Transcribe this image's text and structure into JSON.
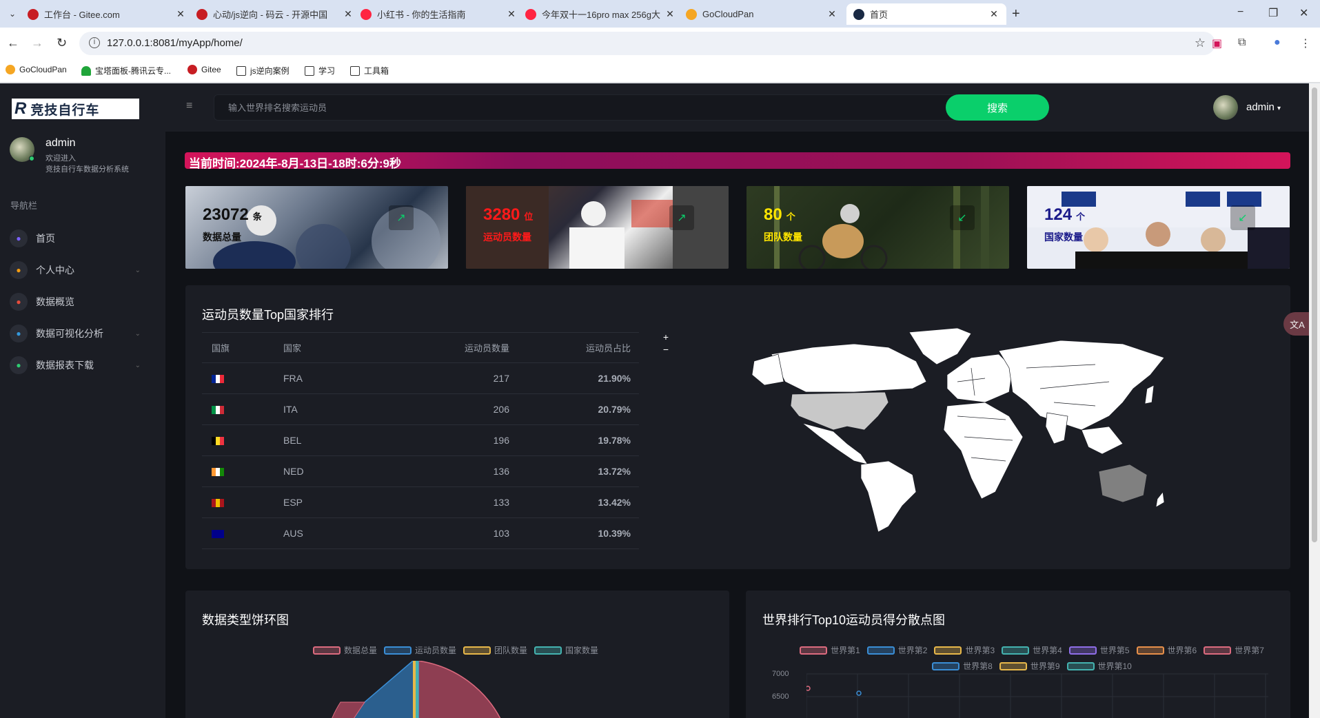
{
  "browser": {
    "tabs": [
      {
        "title": "工作台 - Gitee.com",
        "icon": "gitee-icon",
        "color": "#c71d23"
      },
      {
        "title": "心动/js逆向 - 码云 - 开源中国",
        "icon": "gitee-icon",
        "color": "#c71d23"
      },
      {
        "title": "小红书 - 你的生活指南",
        "icon": "xiaohongshu-icon",
        "color": "#ff2442"
      },
      {
        "title": "今年双十一16pro max 256g大",
        "icon": "xiaohongshu-icon",
        "color": "#ff2442"
      },
      {
        "title": "GoCloudPan",
        "icon": "gocloudpan-icon",
        "color": "#f5a623"
      },
      {
        "title": "首页",
        "icon": "app-logo-icon",
        "color": "#1a2a44",
        "active": true
      }
    ],
    "url": "127.0.0.1:8081/myApp/home/",
    "bookmarks": [
      "GoCloudPan",
      "宝塔面板-腾讯云专...",
      "Gitee",
      "js逆向案例",
      "学习",
      "工具箱"
    ]
  },
  "sidebar": {
    "logo_text": "竞技自行车",
    "user": {
      "name": "admin",
      "line1": "欢迎进入",
      "line2": "竞技自行车数据分析系统"
    },
    "nav_header": "导航栏",
    "items": [
      {
        "label": "首页",
        "icon": "home-icon",
        "color": "#7b61ff",
        "has_children": false
      },
      {
        "label": "个人中心",
        "icon": "user-icon",
        "color": "#f39c12",
        "has_children": true
      },
      {
        "label": "数据概览",
        "icon": "database-icon",
        "color": "#e74c3c",
        "has_children": false
      },
      {
        "label": "数据可视化分析",
        "icon": "chart-icon",
        "color": "#3498db",
        "has_children": true
      },
      {
        "label": "数据报表下载",
        "icon": "download-icon",
        "color": "#2ecc71",
        "has_children": true
      }
    ]
  },
  "topbar": {
    "search_placeholder": "输入世界排名搜索运动员",
    "search_button": "搜索",
    "username": "admin"
  },
  "time_text": "当前时间:2024年-8月-13日-18时:6分:9秒",
  "stats": [
    {
      "value": "23072",
      "unit": "条",
      "label": "数据总量",
      "color": "#111111",
      "arrow": "↗"
    },
    {
      "value": "3280",
      "unit": "位",
      "label": "运动员数量",
      "color": "#ff1a1a",
      "arrow": "↗"
    },
    {
      "value": "80",
      "unit": "个",
      "label": "团队数量",
      "color": "#ffe600",
      "arrow": "↙"
    },
    {
      "value": "124",
      "unit": "个",
      "label": "国家数量",
      "color": "#1a1a8a",
      "arrow": "↙"
    }
  ],
  "country_panel": {
    "title": "运动员数量Top国家排行",
    "headers": [
      "国旗",
      "国家",
      "运动员数量",
      "运动员占比"
    ],
    "rows": [
      {
        "country": "FRA",
        "count": "217",
        "pct": "21.90%",
        "flag": [
          "#002395",
          "#ffffff",
          "#ed2939"
        ]
      },
      {
        "country": "ITA",
        "count": "206",
        "pct": "20.79%",
        "flag": [
          "#009246",
          "#ffffff",
          "#ce2b37"
        ]
      },
      {
        "country": "BEL",
        "count": "196",
        "pct": "19.78%",
        "flag": [
          "#000000",
          "#fdda24",
          "#ef3340"
        ]
      },
      {
        "country": "NED",
        "count": "136",
        "pct": "13.72%",
        "flag": [
          "#ff9933",
          "#ffffff",
          "#138808"
        ]
      },
      {
        "country": "ESP",
        "count": "133",
        "pct": "13.42%",
        "flag": [
          "#aa151b",
          "#f1bf00",
          "#aa151b"
        ]
      },
      {
        "country": "AUS",
        "count": "103",
        "pct": "10.39%",
        "flag": [
          "#00008b",
          "#00008b",
          "#00008b"
        ]
      }
    ],
    "zoom_in": "+",
    "zoom_out": "−"
  },
  "pie_panel": {
    "title": "数据类型饼环图",
    "legend": [
      {
        "label": "数据总量",
        "color": "#dd6b7f"
      },
      {
        "label": "运动员数量",
        "color": "#3a8ed6"
      },
      {
        "label": "团队数量",
        "color": "#e8b84a"
      },
      {
        "label": "国家数量",
        "color": "#44b3b0"
      }
    ]
  },
  "scatter_panel": {
    "title": "世界排行Top10运动员得分散点图",
    "legend": [
      {
        "label": "世界第1",
        "color": "#dd6b7f"
      },
      {
        "label": "世界第2",
        "color": "#3a8ed6"
      },
      {
        "label": "世界第3",
        "color": "#e8b84a"
      },
      {
        "label": "世界第4",
        "color": "#44b3b0"
      },
      {
        "label": "世界第5",
        "color": "#8f6ee8"
      },
      {
        "label": "世界第6",
        "color": "#e8904a"
      },
      {
        "label": "世界第7",
        "color": "#dd6b7f"
      },
      {
        "label": "世界第8",
        "color": "#3a8ed6"
      },
      {
        "label": "世界第9",
        "color": "#e8b84a"
      },
      {
        "label": "世界第10",
        "color": "#44b3b0"
      }
    ],
    "y_ticks": [
      "7000",
      "6500"
    ]
  }
}
